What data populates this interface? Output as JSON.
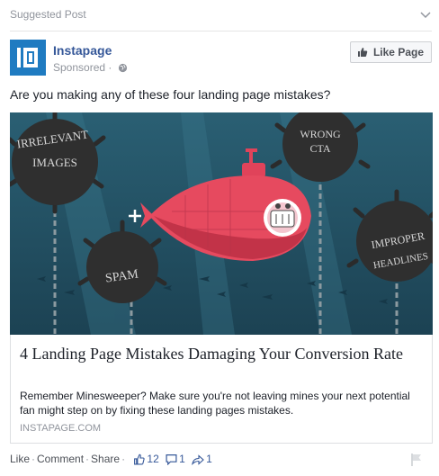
{
  "top_label": "Suggested Post",
  "page": {
    "name": "Instapage",
    "sponsored": "Sponsored",
    "separator": "·",
    "like_button": "Like Page",
    "brand_color": "#1f7bc1"
  },
  "message": "Are you making any of these four landing page mistakes?",
  "image": {
    "mines": [
      {
        "line1": "IRRELEVANT",
        "line2": "IMAGES"
      },
      {
        "line1": "WRONG",
        "line2": "CTA"
      },
      {
        "line1": "SPAM",
        "line2": ""
      },
      {
        "line1": "IMPROPER",
        "line2": "HEADLINES"
      }
    ]
  },
  "link": {
    "title": "4 Landing Page Mistakes Damaging Your Conversion Rate",
    "description": "Remember Minesweeper? Make sure you're not leaving mines your next potential fan might step on by fixing these landing pages mistakes.",
    "domain": "INSTAPAGE.COM"
  },
  "actions": {
    "like": "Like",
    "comment": "Comment",
    "share": "Share",
    "likes_count": "12",
    "comments_count": "1",
    "shares_count": "1",
    "icons": [
      "thumbs-up-icon",
      "comment-icon",
      "share-icon",
      "flag-icon"
    ]
  }
}
